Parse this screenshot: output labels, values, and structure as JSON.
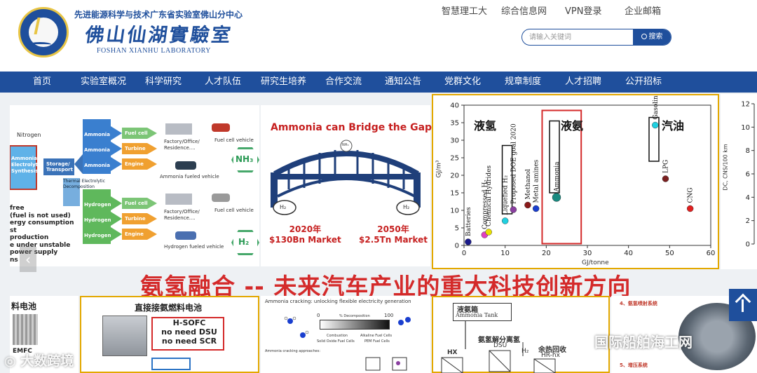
{
  "header": {
    "org_top": "先进能源科学与技术广东省实验室佛山分中心",
    "org_calligraphy": "佛山仙湖實驗室",
    "org_english": "FOSHAN XIANHU LABORATORY",
    "toplinks": [
      "智慧理工大",
      "综合信息网",
      "VPN登录",
      "企业邮箱"
    ],
    "search": {
      "placeholder": "请输入关键词",
      "button": "搜索"
    }
  },
  "nav": {
    "items": [
      "首页",
      "实验室概况",
      "科学研究",
      "人才队伍",
      "研究生培养",
      "合作交流",
      "通知公告",
      "党群文化",
      "规章制度",
      "人才招聘",
      "公开招标"
    ]
  },
  "banner": {
    "diagram": {
      "nitrogen": "Nitrogen",
      "left_box": [
        "Ammonia",
        "Electrolytic",
        "Synthesis"
      ],
      "storage": "Storage/ Transport",
      "thermal": "Thermal Electrolytic Decomposition",
      "ammonia_rows": [
        "Ammonia",
        "Ammonia",
        "Ammonia"
      ],
      "hydrogen_rows": [
        "Hydrogen",
        "Hydrogen",
        "Hydrogen"
      ],
      "devices_top": [
        "Fuel cell",
        "Turbine",
        "Engine"
      ],
      "devices_bottom": [
        "Fuel cell",
        "Turbine",
        "Engine"
      ],
      "factory_top": "Factory/Office/ Residence....",
      "factory_bottom": "Factory/Office/ Residence....",
      "fuel_cell_vehicle_top": "Fuel cell vehicle",
      "ammonia_vehicle": "Ammonia fueled vehicle",
      "fuel_cell_vehicle_bottom": "Fuel cell vehicle",
      "hydrogen_vehicle": "Hydrogen fueled vehicle",
      "left_notes": [
        "free",
        "(fuel is not used)",
        "ergy consumption",
        "st",
        "production",
        "e under unstable",
        "power supply",
        "ns"
      ],
      "nh3_label": "NH₃",
      "h2_label": "H₂"
    },
    "bridge": {
      "title": "Ammonia can Bridge the Gap",
      "left_market": [
        "2020年",
        "$130Bn Market"
      ],
      "right_market": [
        "2050年",
        "$2.5Tn Market"
      ],
      "left_h2": "H₂",
      "right_h2": "H₂",
      "center_label": "NH₃"
    },
    "headline": "氨氢融合 -- 未来汽车产业的重大科技创新方向",
    "lower_panels": {
      "left_title": "料电池",
      "left_caption": "EMFC",
      "direct_title": "直接接氨燃料电池",
      "sofc_lines": [
        "H-SOFC",
        "no need DSU",
        "no need SCR"
      ],
      "cracking_title": "Ammonia cracking: unlocking flexible electricity generation",
      "cracking_axis": [
        "0",
        "% Decomposition",
        "100"
      ],
      "cracking_legend": [
        "Combustion",
        "Alkaline Fuel Cells",
        "Solid Oxide Fuel Cells",
        "PEM Fuel Cells"
      ],
      "cracking_sub": "Ammonia cracking approaches:",
      "tank_lines": [
        "液氨箱",
        "Ammonia Tank"
      ],
      "hx": "HX",
      "dsu": "DSU",
      "dsu_cn": "氨氢解分离氢",
      "recovery": "余热回收",
      "hrhx": "HR-hx",
      "n2": "N₂",
      "h2": "H₂",
      "right_title_4": "4、氨氢喷射系统",
      "right_title_5": "5、增压系统"
    }
  },
  "chart_data": [
    {
      "type": "scatter",
      "title": "",
      "xlabel": "GJ/tonne",
      "ylabel": "GJ/m³",
      "xlim": [
        0,
        60
      ],
      "ylim": [
        0,
        40
      ],
      "xticks": [
        0,
        10,
        20,
        30,
        40,
        50,
        60
      ],
      "yticks": [
        0,
        5,
        10,
        15,
        20,
        25,
        30,
        35,
        40
      ],
      "group_labels": [
        "液氢",
        "液氨",
        "汽油"
      ],
      "series": [
        {
          "name": "Batteries",
          "x": 1,
          "y": 1,
          "color": "#1a1a8a"
        },
        {
          "name": "Compressed H₂",
          "x": 5,
          "y": 3,
          "color": "#e040c0"
        },
        {
          "name": "Chemical Hydrides",
          "x": 6,
          "y": 3.8,
          "color": "#e8e000"
        },
        {
          "name": "Liquefied H₂",
          "x": 10,
          "y": 7,
          "color": "#20d0e0"
        },
        {
          "name": "Proposed DOE goal 2020",
          "x": 12,
          "y": 10.2,
          "color": "#8a3fa0"
        },
        {
          "name": "Methanol",
          "x": 15.5,
          "y": 11.5,
          "color": "#8a1a1a"
        },
        {
          "name": "Metal amines",
          "x": 17.5,
          "y": 10.5,
          "color": "#1a3fcf"
        },
        {
          "name": "Ammonia",
          "x": 22.5,
          "y": 13.7,
          "color": "#1a8a80"
        },
        {
          "name": "Gasoline",
          "x": 46.5,
          "y": 34.3,
          "color": "#20d0e0"
        },
        {
          "name": "LPG",
          "x": 49,
          "y": 19,
          "color": "#7a2020"
        },
        {
          "name": "CNG",
          "x": 55,
          "y": 10.5,
          "color": "#e02020"
        }
      ]
    },
    {
      "type": "bar",
      "title": "",
      "ylabel": "DC, CNS/100 km",
      "ylim": [
        0,
        12
      ],
      "yticks": [
        0,
        2,
        4,
        6,
        8,
        10,
        12
      ],
      "categories": [],
      "values": []
    }
  ]
}
